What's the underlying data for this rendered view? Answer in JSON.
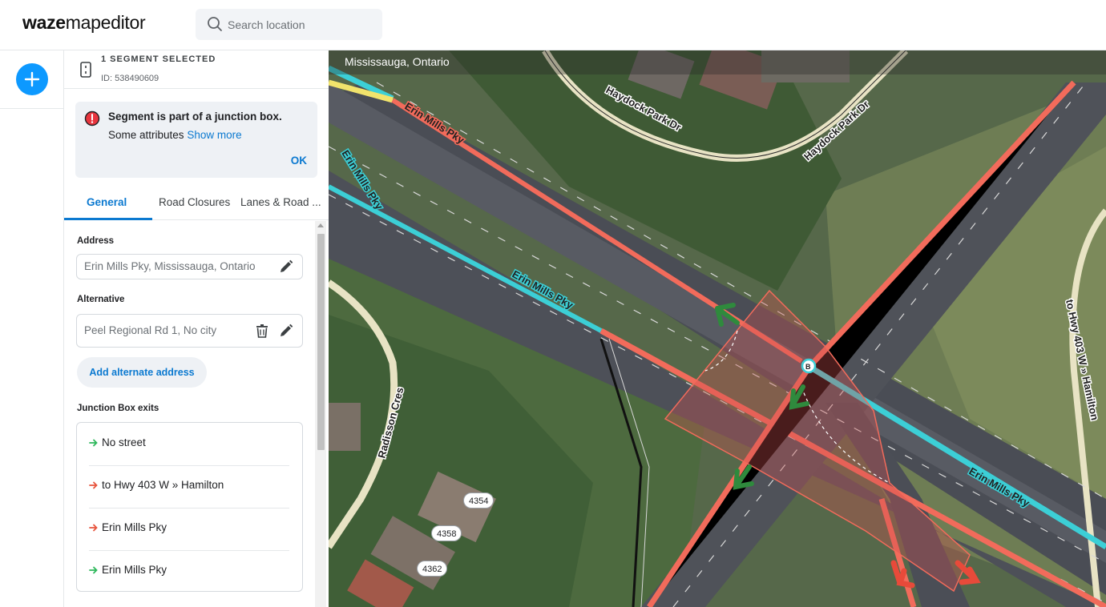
{
  "header": {
    "logo_bold": "waze",
    "logo_light": "mapeditor",
    "search_placeholder": "Search location"
  },
  "segment": {
    "title": "1 SEGMENT SELECTED",
    "id_label": "ID: 538490609"
  },
  "alert": {
    "title": "Segment is part of a junction box.",
    "body": "Some attributes",
    "link": "Show more",
    "ok": "OK"
  },
  "tabs": [
    {
      "label": "General",
      "active": true
    },
    {
      "label": "Road Closures",
      "active": false
    },
    {
      "label": "Lanes & Road ...",
      "active": false
    }
  ],
  "form": {
    "address_label": "Address",
    "address_value": "Erin Mills Pky, Mississauga, Ontario",
    "alternative_label": "Alternative",
    "alternative_value": "Peel Regional Rd 1, No city",
    "add_alt_button": "Add alternate address",
    "junction_label": "Junction Box exits"
  },
  "exits": [
    {
      "name": "No street",
      "color": "#2eb85c"
    },
    {
      "name": "to Hwy 403 W » Hamilton",
      "color": "#e8553e"
    },
    {
      "name": "Erin Mills Pky",
      "color": "#e8553e"
    },
    {
      "name": "Erin Mills Pky",
      "color": "#2eb85c"
    }
  ],
  "map": {
    "city": "Mississauga, Ontario",
    "streets": {
      "haydock1": "Haydock Park Dr",
      "haydock2": "Haydock Park Dr",
      "erin_mills_blue_1": "Erin Mills Pky",
      "erin_mills_blue_2": "Erin Mills Pky",
      "radisson": "Radisson Cres",
      "hwy403": "to Hwy 403 W » Hamilton",
      "erin_mills_red": "Erin Mills Pky",
      "erin_mills_cyan": "Erin Mills Pky"
    },
    "node_label": "B",
    "house_numbers": [
      "4354",
      "4358",
      "4362"
    ]
  },
  "colors": {
    "accent": "#0b79d0",
    "add_button": "#0d99ff",
    "selected_segment": "#f26b5b",
    "alt_segment": "#3ccfd6",
    "exit_allowed": "#2eb85c",
    "exit_restricted": "#e8553e"
  }
}
